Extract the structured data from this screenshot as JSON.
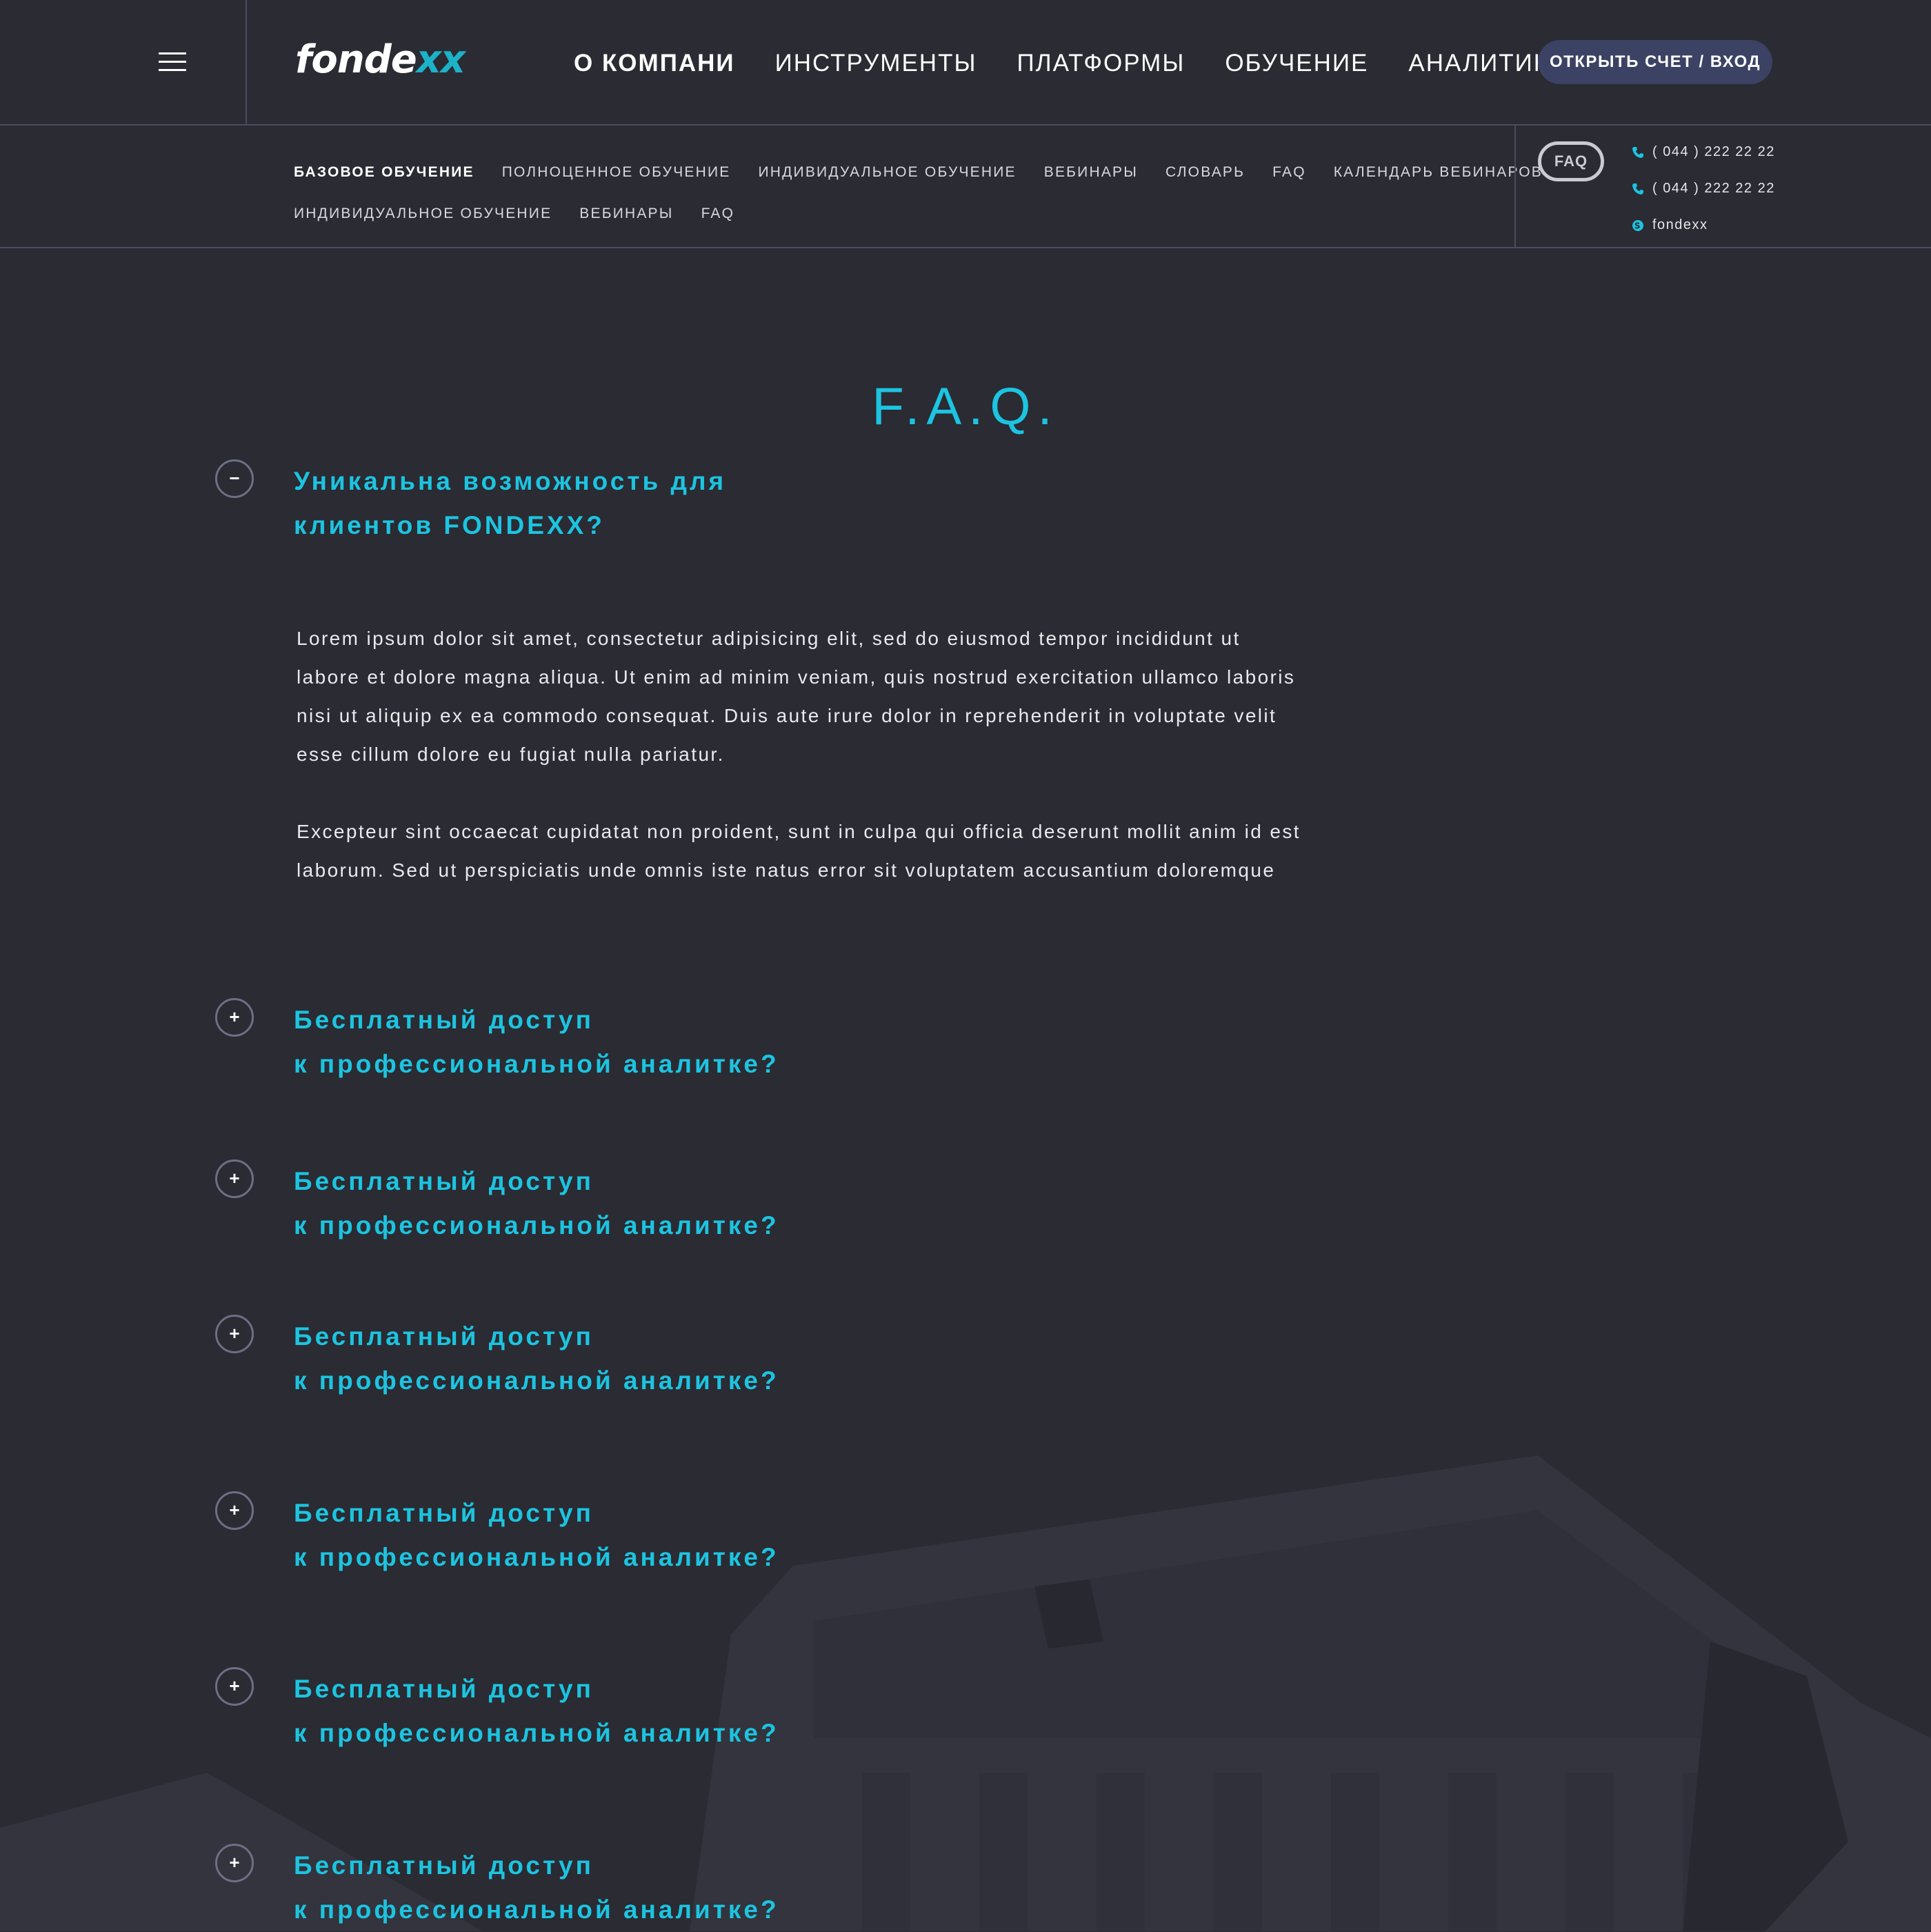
{
  "header": {
    "logo": {
      "text_main": "fonde",
      "text_accent": "xx"
    },
    "nav": [
      "О КОМПАНИ",
      "ИНСТРУМЕНТЫ",
      "ПЛАТФОРМЫ",
      "ОБУЧЕНИЕ",
      "АНАЛИТИКА"
    ],
    "active_nav": "О КОМПАНИ",
    "cta_label": "ОТКРЫТЬ СЧЕТ / ВХОД"
  },
  "subheader": {
    "row1": [
      "БАЗОВОЕ ОБУЧЕНИЕ",
      "ПОЛНОЦЕННОЕ ОБУЧЕНИЕ",
      "ИНДИВИДУАЛЬНОЕ ОБУЧЕНИЕ",
      "ВЕБИНАРЫ",
      "СЛОВАРЬ",
      "FAQ",
      "КАЛЕНДАРЬ ВЕБИНАРОВ"
    ],
    "row2": [
      "ИНДИВИДУАЛЬНОЕ ОБУЧЕНИЕ",
      "ВЕБИНАРЫ",
      "FAQ"
    ],
    "active": "БАЗОВОЕ ОБУЧЕНИЕ",
    "faq_badge": "FAQ",
    "contacts": [
      {
        "icon": "phone-icon",
        "text": "( 044 ) 222 22 22"
      },
      {
        "icon": "phone-icon",
        "text": "( 044 ) 222 22 22"
      },
      {
        "icon": "skype-icon",
        "text": "fondexx"
      }
    ]
  },
  "page": {
    "title": "F.A.Q."
  },
  "faq": [
    {
      "expanded": true,
      "toggle": "−",
      "lines": [
        "Уникальна возможность для",
        "клиентов FONDEXX?"
      ]
    },
    {
      "expanded": false,
      "toggle": "+",
      "lines": [
        "Бесплатный доступ",
        "к профессиональной аналитке?"
      ]
    },
    {
      "expanded": false,
      "toggle": "+",
      "lines": [
        "Бесплатный доступ",
        "к профессиональной аналитке?"
      ]
    },
    {
      "expanded": false,
      "toggle": "+",
      "lines": [
        "Бесплатный доступ",
        "к профессиональной аналитке?"
      ]
    },
    {
      "expanded": false,
      "toggle": "+",
      "lines": [
        "Бесплатный доступ",
        "к профессиональной аналитке?"
      ]
    },
    {
      "expanded": false,
      "toggle": "+",
      "lines": [
        "Бесплатный доступ",
        "к профессиональной аналитке?"
      ]
    },
    {
      "expanded": false,
      "toggle": "+",
      "lines": [
        "Бесплатный доступ",
        "к профессиональной аналитке?"
      ]
    }
  ],
  "answer": {
    "paragraphs": [
      [
        "Lorem ipsum dolor sit amet, consectetur adipisicing elit, sed do eiusmod tempor incididunt ut",
        "labore et dolore magna aliqua. Ut enim ad minim veniam, quis nostrud exercitation ullamco laboris",
        "nisi ut aliquip ex ea commodo consequat. Duis aute irure dolor in reprehenderit in voluptate velit",
        "esse cillum dolore eu fugiat nulla pariatur."
      ],
      [
        "Excepteur sint occaecat cupidatat non proident, sunt in culpa qui officia deserunt mollit anim id est",
        "laborum. Sed ut perspiciatis unde omnis iste natus error sit voluptatem accusantium doloremque"
      ]
    ]
  },
  "colors": {
    "background": "#2a2b33",
    "accent": "#1cc4e0",
    "cta": "#3b4263",
    "divider": "#4a4c5e"
  }
}
